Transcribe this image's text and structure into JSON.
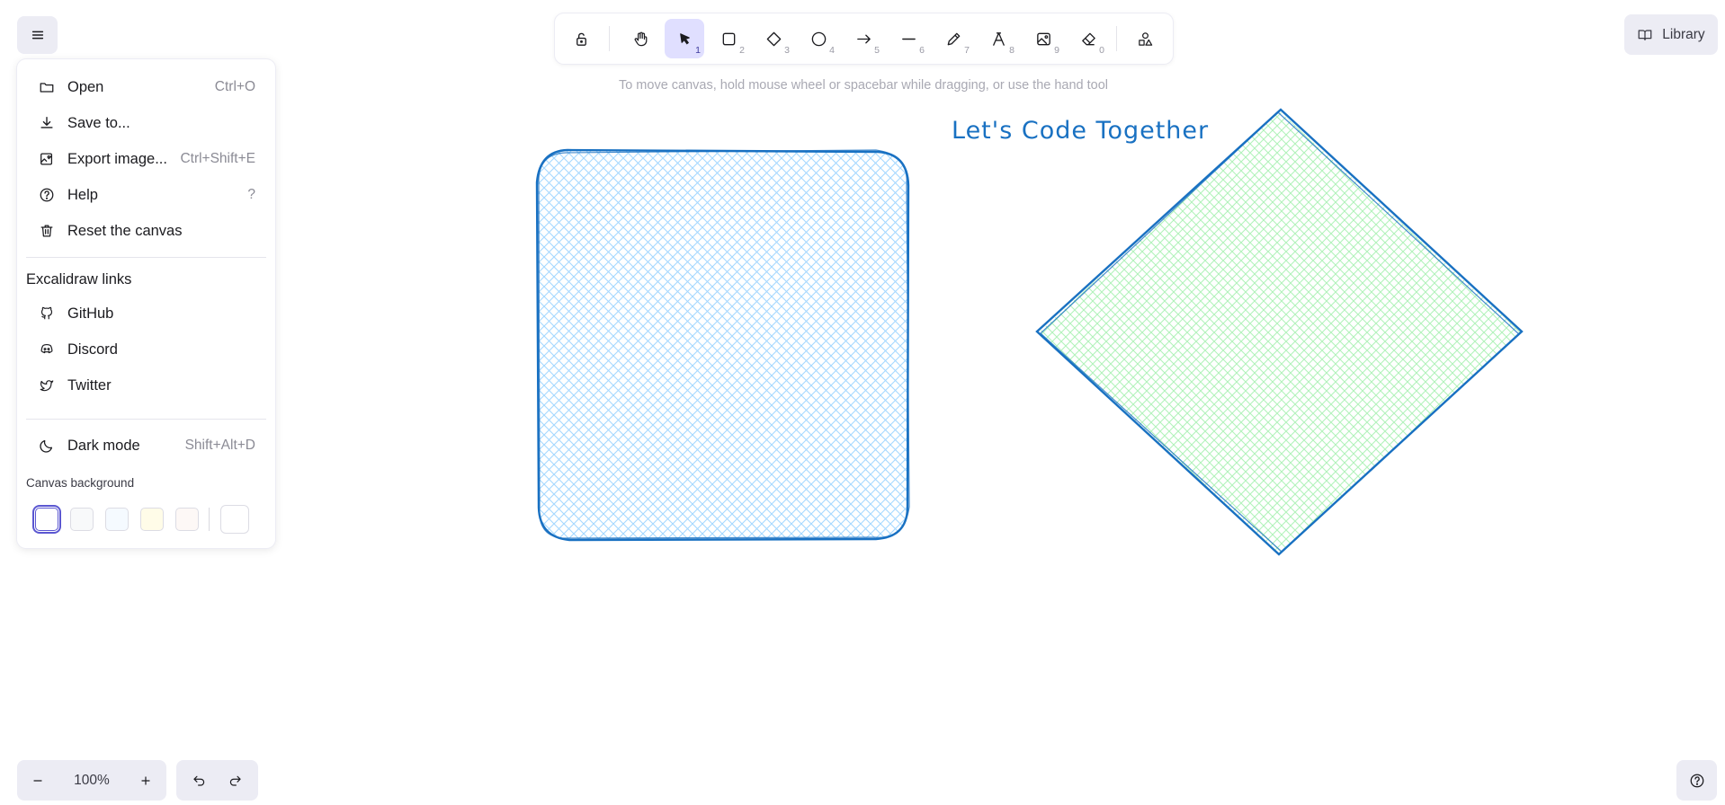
{
  "menu": {
    "items": [
      {
        "label": "Open",
        "shortcut": "Ctrl+O",
        "icon": "folder-icon"
      },
      {
        "label": "Save to...",
        "shortcut": "",
        "icon": "download-icon"
      },
      {
        "label": "Export image...",
        "shortcut": "Ctrl+Shift+E",
        "icon": "export-image-icon"
      },
      {
        "label": "Help",
        "shortcut": "?",
        "icon": "help-icon"
      },
      {
        "label": "Reset the canvas",
        "shortcut": "",
        "icon": "trash-icon"
      }
    ],
    "links_heading": "Excalidraw links",
    "links": [
      {
        "label": "GitHub",
        "icon": "github-icon"
      },
      {
        "label": "Discord",
        "icon": "discord-icon"
      },
      {
        "label": "Twitter",
        "icon": "twitter-icon"
      }
    ],
    "dark_mode": {
      "label": "Dark mode",
      "shortcut": "Shift+Alt+D",
      "icon": "moon-icon"
    },
    "canvas_background_label": "Canvas background",
    "swatches": [
      "#ffffff",
      "#f8f9fa",
      "#f5faff",
      "#fffce8",
      "#fdf8f6"
    ],
    "selected_swatch": "#ffffff",
    "custom_color": "#ffffff"
  },
  "toolbar": {
    "tools": [
      {
        "name": "lock",
        "key": "",
        "icon": "lock-icon"
      },
      {
        "name": "hand",
        "key": "",
        "icon": "hand-icon"
      },
      {
        "name": "selection",
        "key": "1",
        "icon": "pointer-icon",
        "active": true
      },
      {
        "name": "rectangle",
        "key": "2",
        "icon": "rectangle-icon"
      },
      {
        "name": "diamond",
        "key": "3",
        "icon": "diamond-icon"
      },
      {
        "name": "ellipse",
        "key": "4",
        "icon": "ellipse-icon"
      },
      {
        "name": "arrow",
        "key": "5",
        "icon": "arrow-icon"
      },
      {
        "name": "line",
        "key": "6",
        "icon": "line-icon"
      },
      {
        "name": "draw",
        "key": "7",
        "icon": "pencil-icon"
      },
      {
        "name": "text",
        "key": "8",
        "icon": "text-icon"
      },
      {
        "name": "image",
        "key": "9",
        "icon": "image-icon"
      },
      {
        "name": "eraser",
        "key": "0",
        "icon": "eraser-icon"
      },
      {
        "name": "more-tools",
        "key": "",
        "icon": "shapes-icon"
      }
    ]
  },
  "hint": "To move canvas, hold mouse wheel or spacebar while dragging, or use the hand tool",
  "library_label": "Library",
  "zoom": {
    "level": "100%"
  },
  "canvas": {
    "title_text": "Let's Code Together",
    "stroke_color": "#1971c2",
    "rect_fill": "#a5d8ff",
    "diamond_fill": "#b2f2bb"
  }
}
